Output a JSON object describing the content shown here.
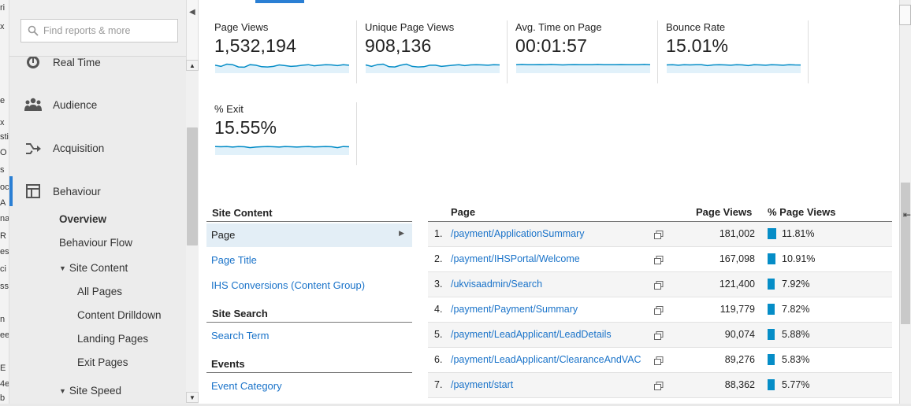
{
  "left_strip": [
    "ri",
    "x",
    "e",
    "x",
    "sti",
    "O",
    "s",
    "oc",
    "A",
    "na",
    "R",
    "esl",
    "ci",
    "ss",
    "n",
    "ee",
    "E",
    "4e",
    "b"
  ],
  "search": {
    "placeholder": "Find reports & more"
  },
  "sidebar": {
    "items": [
      {
        "label": "Real Time",
        "icon": "clock-icon"
      },
      {
        "label": "Audience",
        "icon": "people-icon"
      },
      {
        "label": "Acquisition",
        "icon": "acquisition-arrows-icon"
      },
      {
        "label": "Behaviour",
        "icon": "behaviour-layout-icon"
      }
    ],
    "behaviour_sub": {
      "overview": "Overview",
      "flow": "Behaviour Flow",
      "site_content": "Site Content",
      "all_pages": "All Pages",
      "drilldown": "Content Drilldown",
      "landing": "Landing Pages",
      "exit": "Exit Pages",
      "site_speed": "Site Speed"
    }
  },
  "metrics": [
    {
      "label": "Page Views",
      "value": "1,532,194",
      "spark": [
        0.45,
        0.35,
        0.55,
        0.5,
        0.3,
        0.28,
        0.5,
        0.45,
        0.32,
        0.3,
        0.35,
        0.48,
        0.42,
        0.35,
        0.38,
        0.45,
        0.5,
        0.4,
        0.45,
        0.5,
        0.48,
        0.42,
        0.5,
        0.45
      ]
    },
    {
      "label": "Unique Page Views",
      "value": "908,136",
      "spark": [
        0.48,
        0.35,
        0.5,
        0.55,
        0.32,
        0.3,
        0.45,
        0.55,
        0.35,
        0.3,
        0.32,
        0.45,
        0.45,
        0.35,
        0.4,
        0.45,
        0.5,
        0.42,
        0.48,
        0.5,
        0.48,
        0.45,
        0.5,
        0.48
      ]
    },
    {
      "label": "Avg. Time on Page",
      "value": "00:01:57",
      "spark": [
        0.5,
        0.52,
        0.5,
        0.49,
        0.51,
        0.5,
        0.52,
        0.5,
        0.48,
        0.5,
        0.51,
        0.5,
        0.49,
        0.5,
        0.52,
        0.5,
        0.49,
        0.5,
        0.51,
        0.5,
        0.49,
        0.5,
        0.52,
        0.5
      ]
    },
    {
      "label": "Bounce Rate",
      "value": "15.01%",
      "spark": [
        0.48,
        0.5,
        0.45,
        0.5,
        0.48,
        0.5,
        0.5,
        0.42,
        0.48,
        0.5,
        0.48,
        0.45,
        0.5,
        0.48,
        0.42,
        0.5,
        0.48,
        0.45,
        0.5,
        0.48,
        0.45,
        0.5,
        0.48,
        0.47
      ]
    },
    {
      "label": "% Exit",
      "value": "15.55%",
      "spark": [
        0.5,
        0.48,
        0.5,
        0.45,
        0.5,
        0.48,
        0.4,
        0.45,
        0.48,
        0.5,
        0.48,
        0.45,
        0.5,
        0.48,
        0.45,
        0.48,
        0.5,
        0.46,
        0.48,
        0.5,
        0.48,
        0.4,
        0.5,
        0.48
      ]
    }
  ],
  "site_content": {
    "heading": "Site Content",
    "page": "Page",
    "page_title": "Page Title",
    "ihs": "IHS Conversions (Content Group)",
    "site_search": "Site Search",
    "search_term": "Search Term",
    "events": "Events",
    "event_category": "Event Category"
  },
  "table": {
    "col_page": "Page",
    "col_views": "Page Views",
    "col_pct": "% Page Views",
    "rows": [
      {
        "idx": "1.",
        "page": "/payment/ApplicationSummary",
        "views": "181,002",
        "pct": "11.81%",
        "share": 11.81
      },
      {
        "idx": "2.",
        "page": "/payment/IHSPortal/Welcome",
        "views": "167,098",
        "pct": "10.91%",
        "share": 10.91
      },
      {
        "idx": "3.",
        "page": "/ukvisaadmin/Search",
        "views": "121,400",
        "pct": "7.92%",
        "share": 7.92
      },
      {
        "idx": "4.",
        "page": "/payment/Payment/Summary",
        "views": "119,779",
        "pct": "7.82%",
        "share": 7.82
      },
      {
        "idx": "5.",
        "page": "/payment/LeadApplicant/LeadDetails",
        "views": "90,074",
        "pct": "5.88%",
        "share": 5.88
      },
      {
        "idx": "6.",
        "page": "/payment/LeadApplicant/ClearanceAndVAC",
        "views": "89,276",
        "pct": "5.83%",
        "share": 5.83
      },
      {
        "idx": "7.",
        "page": "/payment/start",
        "views": "88,362",
        "pct": "5.77%",
        "share": 5.77
      }
    ]
  },
  "colors": {
    "accent": "#2a7fd4",
    "link": "#1a73c9",
    "bar": "#058dc7",
    "spark_line": "#058dc7",
    "spark_fill": "#e1f1fa"
  }
}
